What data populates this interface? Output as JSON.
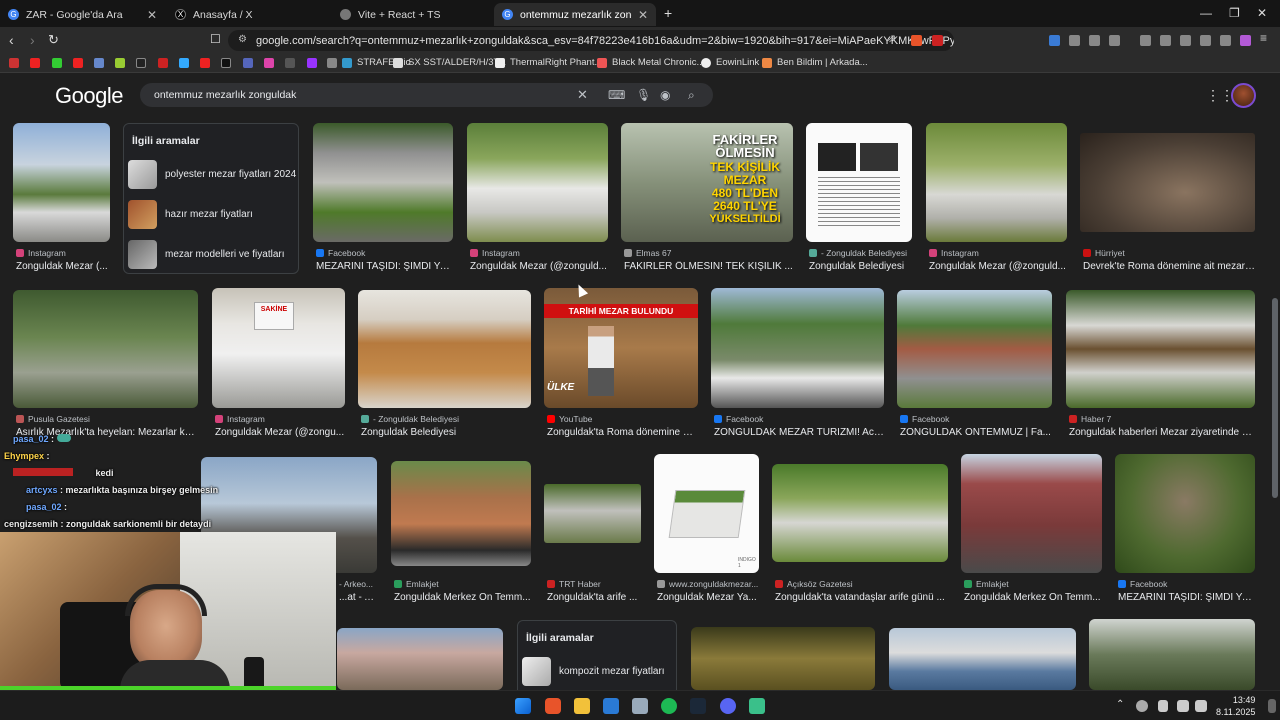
{
  "browser": {
    "tabs": [
      {
        "label": "ZAR - Google'da Ara",
        "icon": "google-icon",
        "active": false
      },
      {
        "label": "Anasayfa / X",
        "icon": "x-icon",
        "active": false
      },
      {
        "label": "Vite + React + TS",
        "icon": "globe-icon",
        "active": false
      },
      {
        "label": "ontemmuz mezarlık zonguldak",
        "icon": "google-icon",
        "active": true
      }
    ],
    "new_tab": "+",
    "url": "google.com/search?q=ontemmuz+mezarlık+zonguldak&sca_esv=84f78223e416b16a&udm=2&biw=1920&bih=917&ei=MiAPaeKYKMK2wPAPyduk...",
    "bookmarks": [
      "STRAFES.io",
      "SX SST/ALDER/H/3T...",
      "ThermalRight Phant...",
      "Black Metal Chronic...",
      "EowinLink",
      "Ben Bildim | Arkada..."
    ]
  },
  "google": {
    "logo": "Google",
    "query": "ontemmuz mezarlık zonguldak"
  },
  "related_top": {
    "heading": "İlgili aramalar",
    "items": [
      "polyester mezar fiyatları 2024",
      "hazır mezar fiyatları",
      "mezar modelleri ve fiyatları"
    ]
  },
  "related_bottom": {
    "heading": "İlgili aramalar",
    "items": [
      "kompozit mezar fiyatları"
    ]
  },
  "row1": [
    {
      "source": "Instagram",
      "title": "Zonguldak Mezar (...",
      "icon": "instagram-icon"
    },
    {
      "source": "Facebook",
      "title": "MEZARINI TAŞIDI: ŞİMDİ YA...",
      "icon": "facebook-icon"
    },
    {
      "source": "Instagram",
      "title": "Zonguldak Mezar (@zonguld...",
      "icon": "instagram-icon"
    },
    {
      "source": "Elmas 67",
      "title": "FAKİRLER ÖLMESİN! TEK KİŞİLİK ...",
      "icon": "news-icon"
    },
    {
      "source": "- Zonguldak Belediyesi",
      "title": "Zonguldak Belediyesi",
      "icon": "city-icon"
    },
    {
      "source": "Instagram",
      "title": "Zonguldak Mezar (@zonguld...",
      "icon": "instagram-icon"
    },
    {
      "source": "Hürriyet",
      "title": "Devrek'te Roma dönemine ait mezar ...",
      "icon": "news-icon"
    }
  ],
  "row2": [
    {
      "source": "Pusula Gazetesi",
      "title": "Asırlık Mezarlık'ta heyelan: Mezarlar kaydı...",
      "icon": "news-icon"
    },
    {
      "source": "Instagram",
      "title": "Zonguldak Mezar (@zongu...",
      "icon": "instagram-icon"
    },
    {
      "source": "- Zonguldak Belediyesi",
      "title": "Zonguldak Belediyesi",
      "icon": "city-icon"
    },
    {
      "source": "YouTube",
      "title": "Zonguldak'ta Roma dönemine ai...",
      "icon": "youtube-icon"
    },
    {
      "source": "Facebook",
      "title": "ZONGULDAK MEZAR TURİZMİ! Acıl...",
      "icon": "facebook-icon"
    },
    {
      "source": "Facebook",
      "title": "ZONGULDAK ONTEMMUZ | Fa...",
      "icon": "facebook-icon"
    },
    {
      "source": "Haber 7",
      "title": "Zonguldak haberleri Mezar ziyaretinde d...",
      "icon": "news-icon"
    }
  ],
  "row3": [
    {
      "source": "- Arkeo...",
      "title": "...at - Ar...",
      "icon": "news-icon"
    },
    {
      "source": "Emlakjet",
      "title": "Zonguldak Merkez On Temm...",
      "icon": "house-icon"
    },
    {
      "source": "TRT Haber",
      "title": "Zonguldak'ta arife ...",
      "icon": "news-icon"
    },
    {
      "source": "www.zonguldakmezar...",
      "title": "Zonguldak Mezar Ya...",
      "icon": "globe-icon"
    },
    {
      "source": "Açıksöz Gazetesi",
      "title": "Zonguldak'ta vatandaşlar arife günü ...",
      "icon": "news-icon"
    },
    {
      "source": "Emlakjet",
      "title": "Zonguldak Merkez On Temm...",
      "icon": "house-icon"
    },
    {
      "source": "Facebook",
      "title": "MEZARINI TAŞIDI: ŞİMDİ YA...",
      "icon": "facebook-icon"
    }
  ],
  "images": {
    "fakirler_line1": "FAKİRLER",
    "fakirler_line2": "ÖLMESİN",
    "fakirler_line3": "TEK KİŞİLİK",
    "fakirler_line4": "MEZAR",
    "fakirler_line5": "480 TL'DEN",
    "fakirler_line6": "2640 TL'YE",
    "fakirler_line7": "YÜKSELTİLDİ",
    "tarihi_banner": "TARİHİ MEZAR BULUNDU",
    "ulke_logo": "ÜLKE",
    "sakine_text": "SAKİNE",
    "stone_text": "REŞ ELMA RUHU",
    "stone_date1": "D.01",
    "stone_date2": "Ö.14",
    "plant_caption": "INDIGO 1"
  },
  "chat": [
    {
      "user": "pasa_02",
      "message": "",
      "color": "#6fa8ff"
    },
    {
      "user": "Ehympex",
      "message": "",
      "color": "#ffd54a"
    },
    {
      "user": "",
      "message": "kedi",
      "color": "#ff4040"
    },
    {
      "user": "artcyxs",
      "message": "mezarlıkta başınıza birşey gelmesin",
      "color": "#6fa8ff"
    },
    {
      "user": "pasa_02",
      "message": "",
      "color": "#6fa8ff"
    },
    {
      "user": "cengizsemih",
      "message": "zonguldak sarkionemli bir detaydi",
      "color": "#e8e8e8"
    }
  ],
  "clock": {
    "time": "13:49",
    "date": "8.11.2025"
  },
  "colors": {
    "accent": "#8ab4f8",
    "background": "#1f1f1f",
    "card_text": "#e8eaed"
  }
}
